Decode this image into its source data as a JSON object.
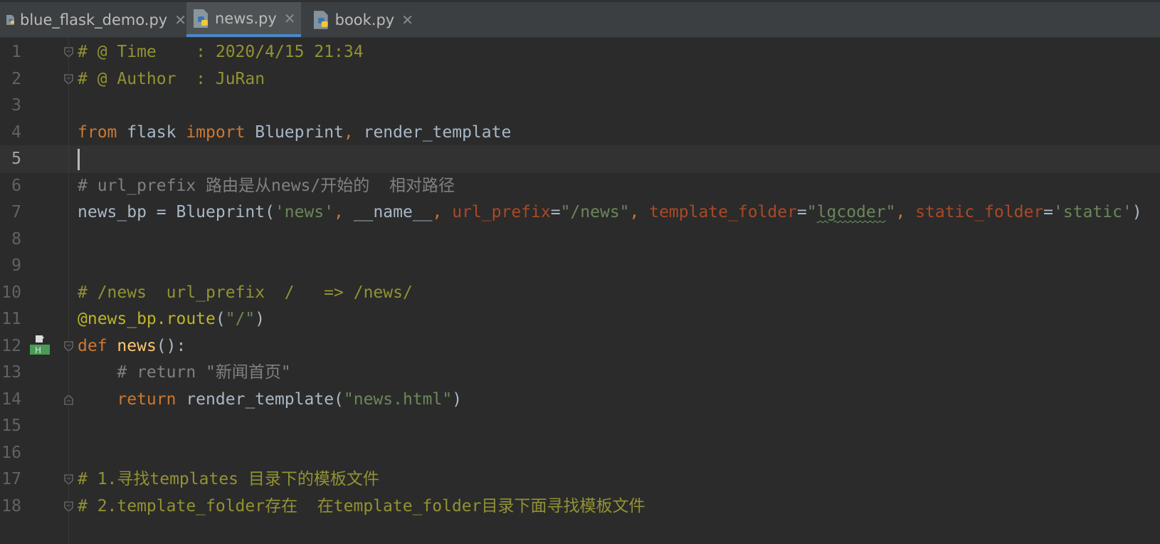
{
  "tabs": [
    {
      "label": "blue_flask_demo.py",
      "active": false,
      "icon": "python-file-icon"
    },
    {
      "label": "news.py",
      "active": true,
      "icon": "python-file-icon"
    },
    {
      "label": "book.py",
      "active": false,
      "icon": "python-file-icon"
    }
  ],
  "colors": {
    "background": "#2b2b2b",
    "tab_active_underline": "#4a88c7",
    "comment": "#808080",
    "keyword": "#cc7832",
    "string": "#6a8759",
    "param": "#aa4926"
  },
  "editor": {
    "current_line": 5,
    "lines": [
      {
        "num": "1",
        "tokens": [
          {
            "t": "# @ Time    : 2020/4/15 21:34",
            "c": "meta"
          }
        ]
      },
      {
        "num": "2",
        "tokens": [
          {
            "t": "# @ Author  : JuRan",
            "c": "meta"
          }
        ]
      },
      {
        "num": "3",
        "tokens": []
      },
      {
        "num": "4",
        "tokens": [
          {
            "t": "from",
            "c": "kw"
          },
          {
            "t": " flask ",
            "c": "plain"
          },
          {
            "t": "import",
            "c": "kw"
          },
          {
            "t": " Blueprint",
            "c": "plain"
          },
          {
            "t": ",",
            "c": "kw"
          },
          {
            "t": " render_template",
            "c": "plain"
          }
        ]
      },
      {
        "num": "5",
        "tokens": []
      },
      {
        "num": "6",
        "tokens": [
          {
            "t": "# url_prefix 路由是从news/开始的  相对路径",
            "c": "comment"
          }
        ]
      },
      {
        "num": "7",
        "tokens": [
          {
            "t": "news_bp = Blueprint(",
            "c": "plain"
          },
          {
            "t": "'news'",
            "c": "str"
          },
          {
            "t": ", ",
            "c": "kw"
          },
          {
            "t": "__name__",
            "c": "plain"
          },
          {
            "t": ", ",
            "c": "kw"
          },
          {
            "t": "url_prefix",
            "c": "param"
          },
          {
            "t": "=",
            "c": "plain"
          },
          {
            "t": "\"/news\"",
            "c": "str"
          },
          {
            "t": ", ",
            "c": "kw"
          },
          {
            "t": "template_folder",
            "c": "param"
          },
          {
            "t": "=",
            "c": "plain"
          },
          {
            "t": "\"",
            "c": "str"
          },
          {
            "t": "lgcoder",
            "c": "str typo"
          },
          {
            "t": "\"",
            "c": "str"
          },
          {
            "t": ", ",
            "c": "kw"
          },
          {
            "t": "static_folder",
            "c": "param"
          },
          {
            "t": "=",
            "c": "plain"
          },
          {
            "t": "'static'",
            "c": "str"
          },
          {
            "t": ")",
            "c": "plain"
          }
        ]
      },
      {
        "num": "8",
        "tokens": []
      },
      {
        "num": "9",
        "tokens": []
      },
      {
        "num": "10",
        "tokens": [
          {
            "t": "# /news  url_prefix  /   => /news/",
            "c": "meta"
          }
        ]
      },
      {
        "num": "11",
        "tokens": [
          {
            "t": "@news_bp.route",
            "c": "dec"
          },
          {
            "t": "(",
            "c": "plain"
          },
          {
            "t": "\"/\"",
            "c": "str"
          },
          {
            "t": ")",
            "c": "plain"
          }
        ]
      },
      {
        "num": "12",
        "tokens": [
          {
            "t": "def",
            "c": "kw"
          },
          {
            "t": " ",
            "c": "plain"
          },
          {
            "t": "news",
            "c": "fn"
          },
          {
            "t": "():",
            "c": "plain"
          }
        ]
      },
      {
        "num": "13",
        "tokens": [
          {
            "t": "    # return \"新闻首页\"",
            "c": "comment"
          }
        ]
      },
      {
        "num": "14",
        "tokens": [
          {
            "t": "    ",
            "c": "plain"
          },
          {
            "t": "return",
            "c": "kw"
          },
          {
            "t": " render_template(",
            "c": "plain"
          },
          {
            "t": "\"news.html\"",
            "c": "str"
          },
          {
            "t": ")",
            "c": "plain"
          }
        ]
      },
      {
        "num": "15",
        "tokens": []
      },
      {
        "num": "16",
        "tokens": []
      },
      {
        "num": "17",
        "tokens": [
          {
            "t": "# 1.寻找templates 目录下的模板文件",
            "c": "meta"
          }
        ]
      },
      {
        "num": "18",
        "tokens": [
          {
            "t": "# 2.template_folder存在  在template_folder目录下面寻找模板文件",
            "c": "meta"
          }
        ]
      }
    ]
  }
}
